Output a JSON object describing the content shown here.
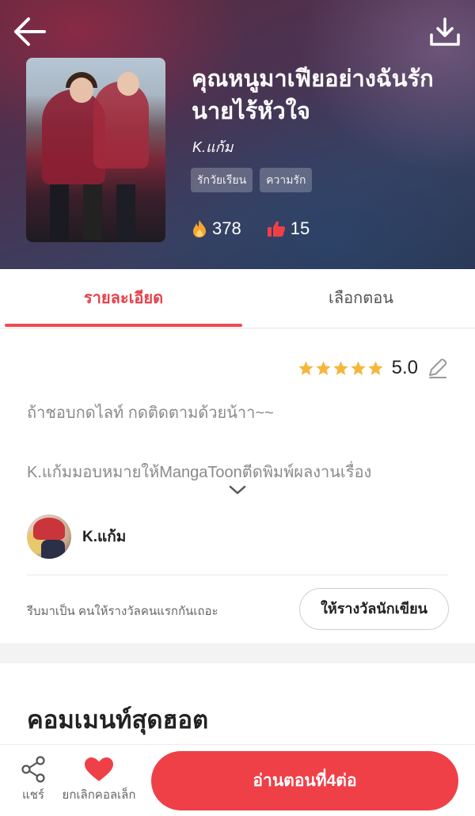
{
  "header": {
    "back_icon": "arrow-left-icon",
    "download_icon": "download-icon"
  },
  "book": {
    "title": "คุณหนูมาเฟียอย่างฉันรักนายไร้หัวใจ",
    "author": "K.แก้ม",
    "tags": [
      "รักวัยเรียน",
      "ความรัก"
    ],
    "views": "378",
    "likes": "15"
  },
  "tabs": [
    {
      "label": "รายละเอียด",
      "active": true
    },
    {
      "label": "เลือกตอน",
      "active": false
    }
  ],
  "details": {
    "rating": "5.0",
    "stars": 5,
    "description_line1": "ถ้าชอบกดไลท์  กดติดตามด้วยน้าา~~",
    "description_line2": "K.แก้มมอบหมายให้MangaToonตีดพิมพ์ผลงานเรื่อง",
    "author_name": "K.แก้ม",
    "reward_prompt": "รีบมาเป็น คนให้รางวัลคนแรกกันเถอะ",
    "reward_button": "ให้รางวัลนักเขียน"
  },
  "comments": {
    "heading": "คอมเมนท์สุดฮอต"
  },
  "bottom_bar": {
    "share_label": "แชร์",
    "favorite_label": "ยกเลิกคอลเล็ก",
    "read_button": "อ่านตอนที่4ต่อ"
  },
  "colors": {
    "accent": "#ef4048",
    "star": "#f5b73b"
  }
}
